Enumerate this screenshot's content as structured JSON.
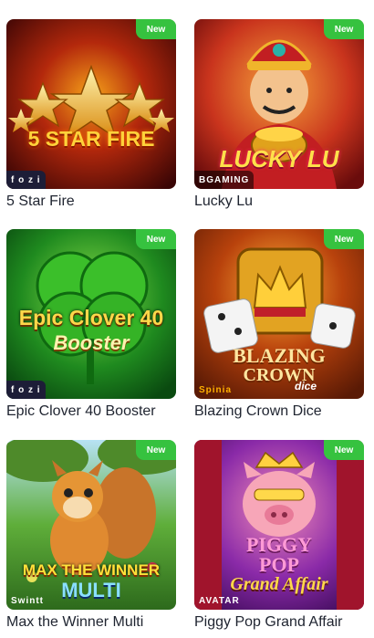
{
  "badge_text": "New",
  "games": [
    {
      "title": "5 Star Fire",
      "logo": "5 STAR FIRE",
      "provider": "f o z i"
    },
    {
      "title": "Lucky Lu",
      "logo": "LUCKY LU",
      "provider": "BGAMING"
    },
    {
      "title": "Epic Clover 40 Booster",
      "logo": "Epic Clover 40",
      "logo2": "Booster",
      "provider": "f o z i"
    },
    {
      "title": "Blazing Crown Dice",
      "logo": "BLAZING",
      "logo2": "CROWN",
      "logo3": "dice",
      "provider": "Spinia"
    },
    {
      "title": "Max the Winner Multi",
      "logo": "MAX THE WINNER",
      "logo2": "MULTI",
      "provider": "Swintt"
    },
    {
      "title": "Piggy Pop Grand Affair",
      "logo": "PIGGY",
      "logo2": "POP",
      "logo3": "Grand Affair",
      "provider": "AVATAR"
    }
  ]
}
